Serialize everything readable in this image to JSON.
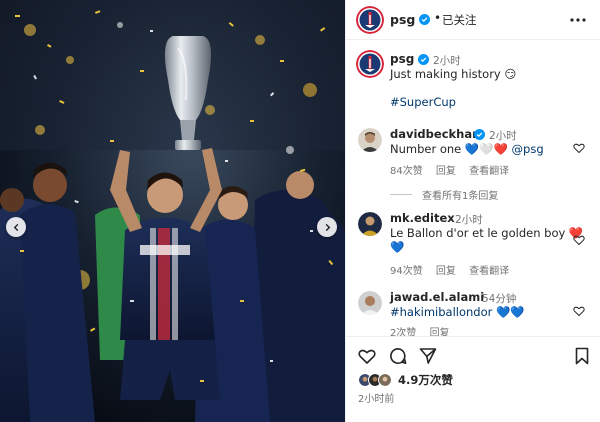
{
  "post": {
    "account": "psg",
    "follow_status": "已关注",
    "header_separator": "•"
  },
  "caption": {
    "username": "psg",
    "time": "2小时",
    "text": "Just making history 😏",
    "hashtag": "#SuperCup"
  },
  "comments": [
    {
      "username": "davidbeckham",
      "verified": true,
      "time": "2小时",
      "text": "Number one 💙🤍❤️",
      "mention": "@psg",
      "likes": "84次赞",
      "reply_label": "回复",
      "translate_label": "查看翻译",
      "view_replies": "查看所有1条回复"
    },
    {
      "username": "mk.editex",
      "verified": false,
      "time": "2小时",
      "text_line1": "Le Ballon d'or et le golden boy ❤️",
      "text_line2": "💙",
      "likes": "94次赞",
      "reply_label": "回复",
      "translate_label": "查看翻译"
    },
    {
      "username": "jawad.el.alami",
      "verified": false,
      "time": "54分钟",
      "text": "#hakimiballondor 💙💙",
      "likes": "2次赞",
      "reply_label": "回复"
    }
  ],
  "footer": {
    "likes_count": "4.9万次赞",
    "post_time": "2小时前"
  },
  "icons": {
    "verified_color": "#0095f6",
    "psg_navy": "#1b3a73",
    "psg_red": "#d7243a"
  }
}
